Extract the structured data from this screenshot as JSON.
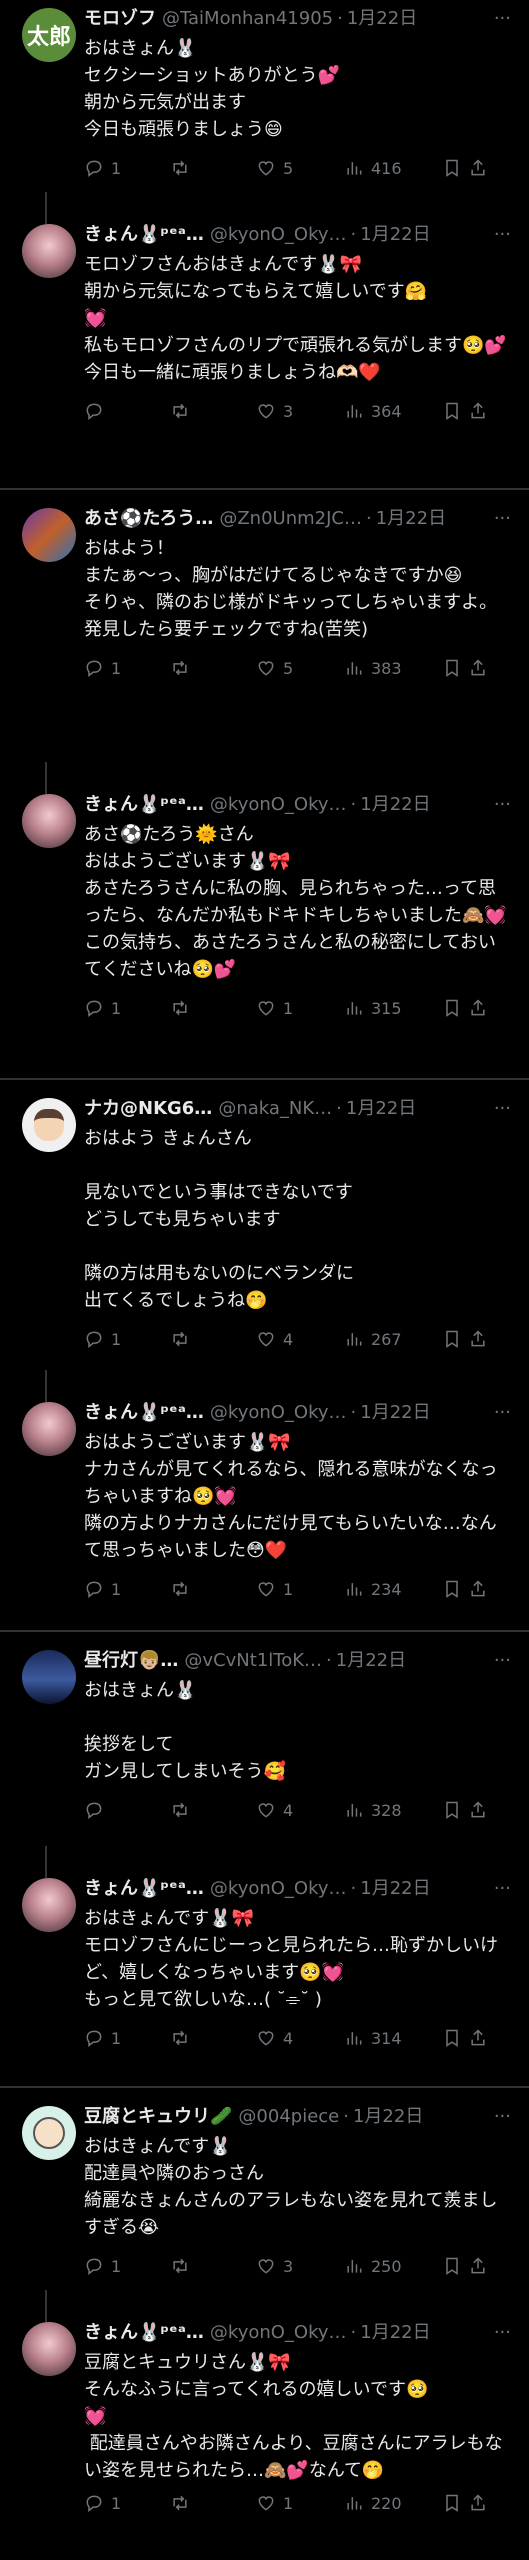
{
  "tweets": [
    {
      "name": "モロゾフ",
      "handle": "@TaiMonhan41905",
      "date": "1月22日",
      "avatar_text": "太郎",
      "text": "おはきょん🐰\nセクシーショットありがとう💕\n朝から元気が出ます\n今日も頑張りましょう😄",
      "replies": "1",
      "retweets": "",
      "likes": "5",
      "views": "416"
    },
    {
      "name": "きょん🐰ᵖᵉᵃ…",
      "handle": "@kyonO_Oky…",
      "date": "1月22日",
      "text": "モロゾフさんおはきょんです🐰🎀\n朝から元気になってもらえて嬉しいです🤗\n💓\n私もモロゾフさんのリプで頑張れる気がします🥺💕\n今日も一緒に頑張りましょうね🫶🏻❤️",
      "replies": "",
      "retweets": "",
      "likes": "3",
      "views": "364"
    },
    {
      "name": "あさ⚽たろう…",
      "handle": "@Zn0Unm2JC…",
      "date": "1月22日",
      "text": "おはよう！\nまたぁ〜っ、胸がはだけてるじゃなきですか😆\nそりゃ、隣のおじ様がドキッってしちゃいますよ。\n発見したら要チェックですね(苦笑)",
      "replies": "1",
      "retweets": "",
      "likes": "5",
      "views": "383"
    },
    {
      "name": "きょん🐰ᵖᵉᵃ…",
      "handle": "@kyonO_Oky…",
      "date": "1月22日",
      "text": "あさ⚽たろう🌞さん\nおはようございます🐰🎀\nあさたろうさんに私の胸、見られちゃった…って思ったら、なんだか私もドキドキしちゃいました🙈💓\nこの気持ち、あさたろうさんと私の秘密にしておいてくださいね🥺💕",
      "replies": "1",
      "retweets": "",
      "likes": "1",
      "views": "315"
    },
    {
      "name": "ナカ@NKG6…",
      "handle": "@naka_NK…",
      "date": "1月22日",
      "text": "おはよう きょんさん\n\n見ないでという事はできないです\nどうしても見ちゃいます\n\n隣の方は用もないのにベランダに\n出てくるでしょうね🤭",
      "replies": "1",
      "retweets": "",
      "likes": "4",
      "views": "267"
    },
    {
      "name": "きょん🐰ᵖᵉᵃ…",
      "handle": "@kyonO_Oky…",
      "date": "1月22日",
      "text": "おはようございます🐰🎀\nナカさんが見てくれるなら、隠れる意味がなくなっちゃいますね🥺💓\n隣の方よりナカさんにだけ見てもらいたいな…なんて思っちゃいました😳❤️",
      "replies": "1",
      "retweets": "",
      "likes": "1",
      "views": "234"
    },
    {
      "name": "昼行灯👦🏼…",
      "handle": "@vCvNt1lToK…",
      "date": "1月22日",
      "text": "おはきょん🐰\n\n挨拶をして\nガン見してしまいそう🥰",
      "replies": "",
      "retweets": "",
      "likes": "4",
      "views": "328"
    },
    {
      "name": "きょん🐰ᵖᵉᵃ…",
      "handle": "@kyonO_Oky…",
      "date": "1月22日",
      "text": "おはきょんです🐰🎀\nモロゾフさんにじーっと見られたら…恥ずかしいけど、嬉しくなっちゃいます🥺💓\nもっと見て欲しいな…( ˘⌯˘ )",
      "replies": "1",
      "retweets": "",
      "likes": "4",
      "views": "314"
    },
    {
      "name": "豆腐とキュウリ🥒",
      "handle": "@004piece",
      "date": "1月22日",
      "text": "おはきょんです🐰\n配達員や隣のおっさん\n綺麗なきょんさんのアラレもない姿を見れて羨ましすぎる😭",
      "replies": "1",
      "retweets": "",
      "likes": "3",
      "views": "250"
    },
    {
      "name": "きょん🐰ᵖᵉᵃ…",
      "handle": "@kyonO_Oky…",
      "date": "1月22日",
      "text": "豆腐とキュウリさん🐰🎀\nそんなふうに言ってくれるの嬉しいです🥺\n💓\n 配達員さんやお隣さんより、豆腐さんにアラレもない姿を見せられたら…🙈💕なんて🤭",
      "replies": "1",
      "retweets": "",
      "likes": "1",
      "views": "220"
    }
  ]
}
